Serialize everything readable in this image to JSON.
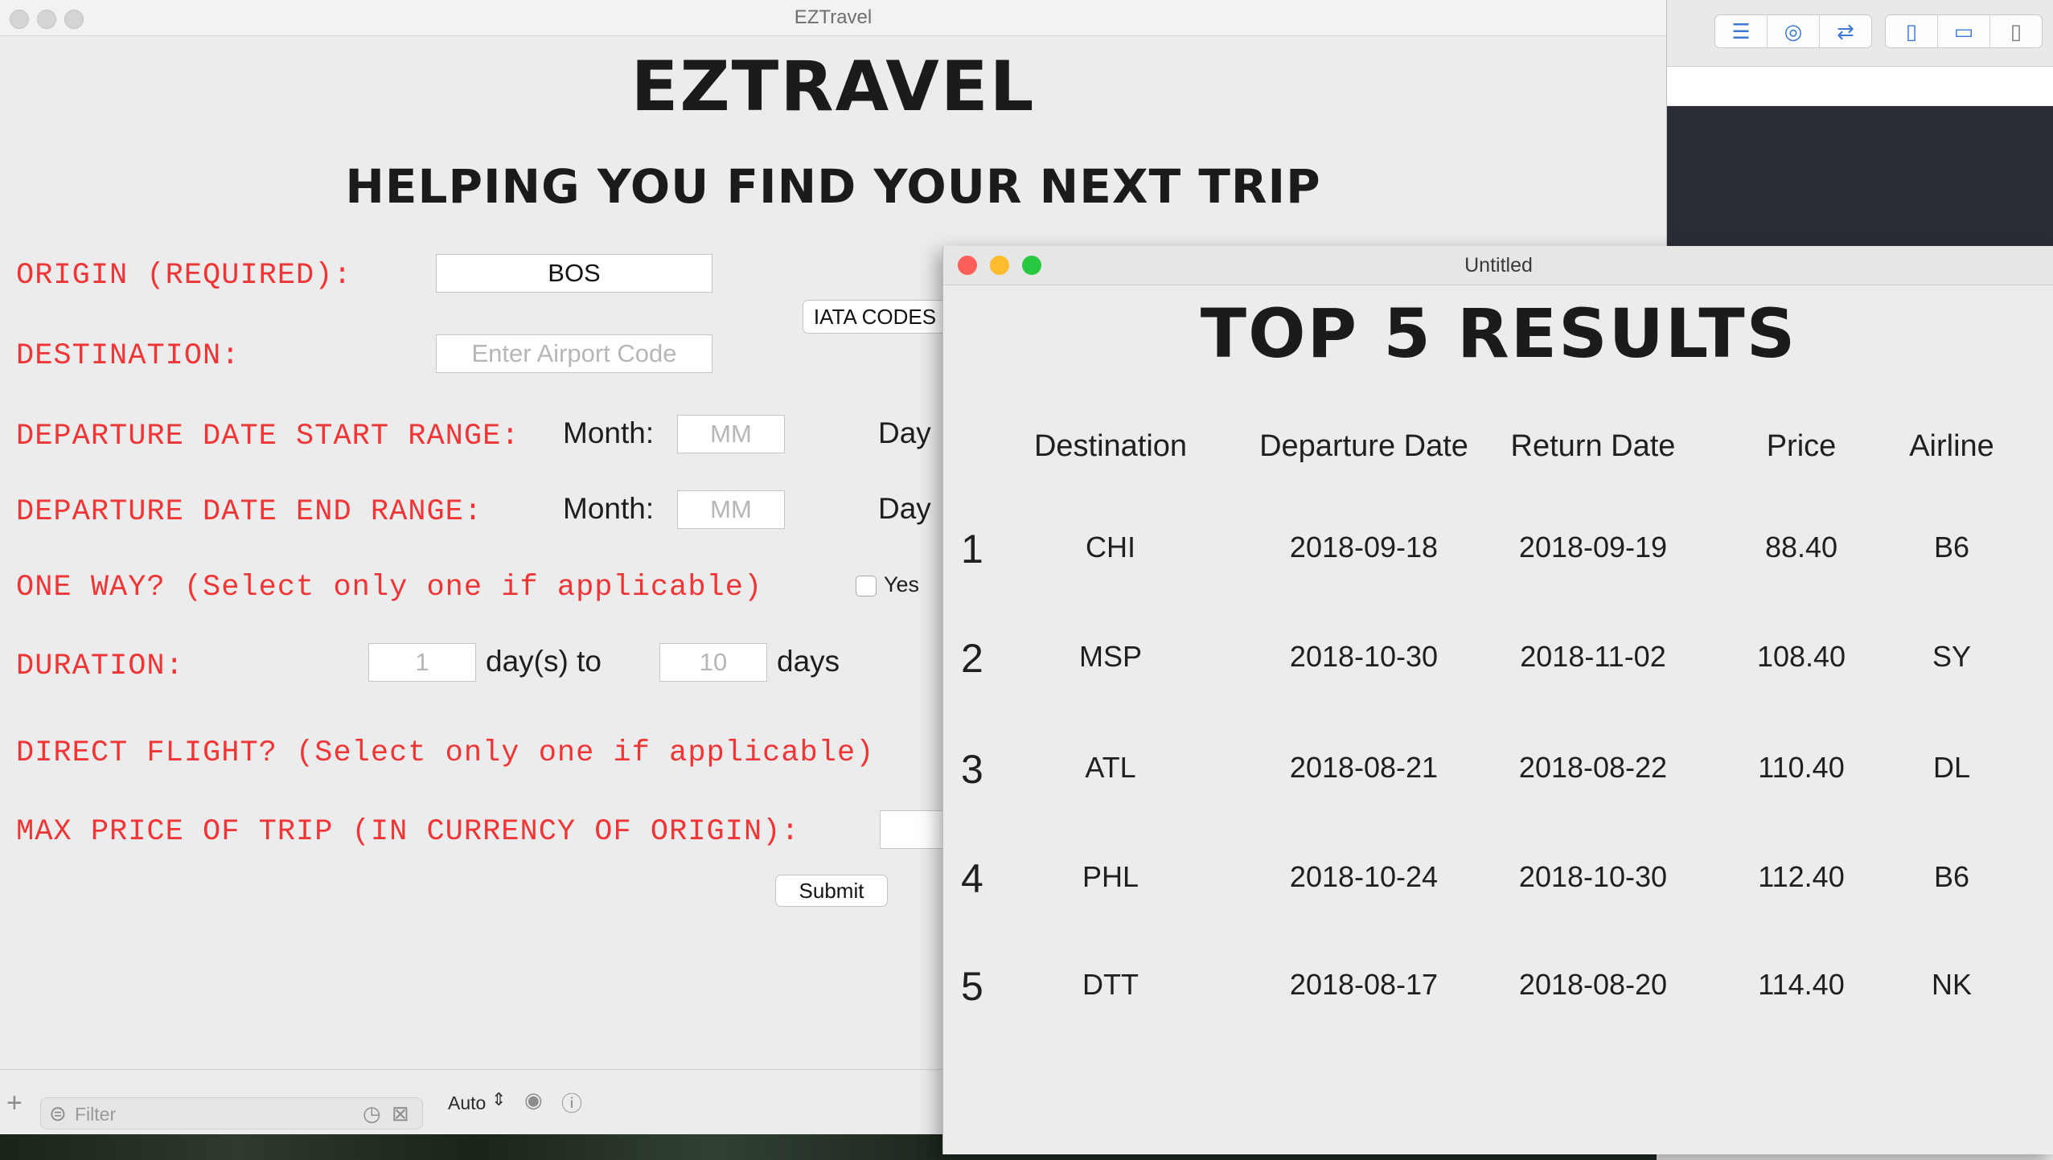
{
  "main_window": {
    "title": "EZTravel",
    "heading": "EZTravel",
    "subheading": "Helping you find your next trip",
    "form": {
      "origin_label": "ORIGIN (REQUIRED):",
      "origin_value": "BOS",
      "iata_button": "IATA CODES",
      "destination_label": "DESTINATION:",
      "destination_placeholder": "Enter Airport Code",
      "dep_start_label": "DEPARTURE DATE START RANGE:",
      "dep_end_label": "DEPARTURE DATE END RANGE:",
      "month_label": "Month:",
      "month_placeholder": "MM",
      "day_label": "Day",
      "one_way_label": "ONE WAY? (Select only one if applicable)",
      "yes_label": "Yes",
      "duration_label": "DURATION:",
      "duration_from": "1",
      "duration_mid": "day(s) to",
      "duration_to": "10",
      "duration_unit": "days",
      "direct_label": "DIRECT FLIGHT? (Select only one if applicable)",
      "max_price_label": "MAX PRICE OF TRIP (IN CURRENCY OF ORIGIN):",
      "submit_button": "Submit"
    }
  },
  "bottom_bar": {
    "filter_placeholder": "Filter",
    "auto_label": "Auto"
  },
  "results_window": {
    "title": "Untitled",
    "heading": "Top 5 Results",
    "columns": [
      "Destination",
      "Departure Date",
      "Return Date",
      "Price",
      "Airline"
    ],
    "rows": [
      {
        "rank": "1",
        "destination": "CHI",
        "departure": "2018-09-18",
        "return": "2018-09-19",
        "price": "88.40",
        "airline": "B6"
      },
      {
        "rank": "2",
        "destination": "MSP",
        "departure": "2018-10-30",
        "return": "2018-11-02",
        "price": "108.40",
        "airline": "SY"
      },
      {
        "rank": "3",
        "destination": "ATL",
        "departure": "2018-08-21",
        "return": "2018-08-22",
        "price": "110.40",
        "airline": "DL"
      },
      {
        "rank": "4",
        "destination": "PHL",
        "departure": "2018-10-24",
        "return": "2018-10-30",
        "price": "112.40",
        "airline": "B6"
      },
      {
        "rank": "5",
        "destination": "DTT",
        "departure": "2018-08-17",
        "return": "2018-08-20",
        "price": "114.40",
        "airline": "NK"
      }
    ]
  },
  "colors": {
    "label_red": "#ef3535",
    "traffic_red": "#fc5f57",
    "traffic_yellow": "#fdbc2e",
    "traffic_green": "#28c840",
    "accent_blue": "#3d7ad6"
  },
  "icons": {
    "toolbar": [
      "text-align-icon",
      "link-rings-icon",
      "swap-arrows-icon",
      "left-panel-icon",
      "bottom-panel-icon",
      "right-panel-icon"
    ],
    "bottom": [
      "add-icon",
      "filter-icon",
      "clock-icon",
      "close-box-icon",
      "stepper-icon",
      "eye-icon",
      "info-icon"
    ]
  }
}
